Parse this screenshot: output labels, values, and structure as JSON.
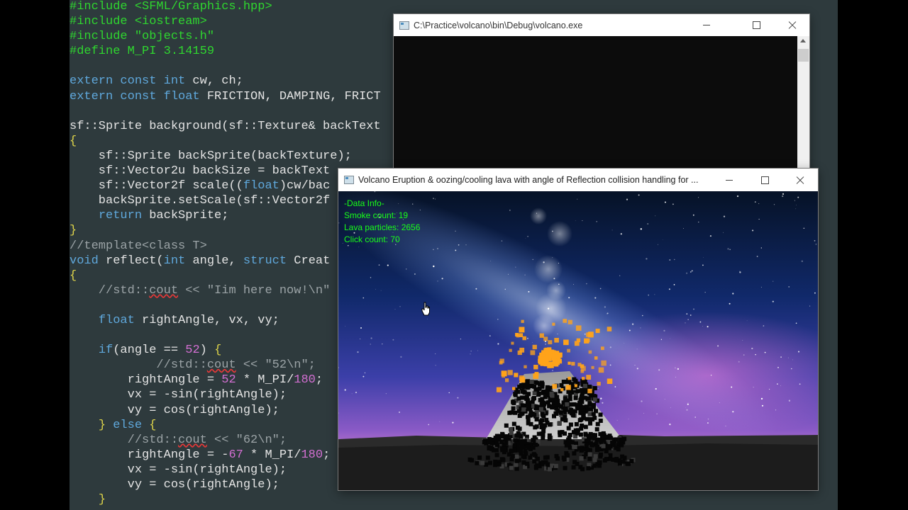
{
  "editor": {
    "lines": [
      [
        {
          "t": "#include <SFML/Graphics.hpp>",
          "c": "pp"
        }
      ],
      [
        {
          "t": "#include <iostream>",
          "c": "pp"
        }
      ],
      [
        {
          "t": "#include \"objects.h\"",
          "c": "pp"
        }
      ],
      [
        {
          "t": "#define M_PI 3.14159",
          "c": "pp"
        }
      ],
      [],
      [
        {
          "t": "extern const int",
          "c": "kw"
        },
        {
          "t": " cw, ch;"
        }
      ],
      [
        {
          "t": "extern const float",
          "c": "kw"
        },
        {
          "t": " FRICTION, DAMPING, FRICT"
        }
      ],
      [],
      [
        {
          "t": "sf::Sprite background(sf::Texture& backText"
        }
      ],
      [
        {
          "t": "{",
          "c": "br"
        }
      ],
      [
        {
          "t": "    sf::Sprite backSprite(backTexture);"
        }
      ],
      [
        {
          "t": "    sf::Vector2u backSize = backText"
        }
      ],
      [
        {
          "t": "    sf::Vector2f scale(("
        },
        {
          "t": "float",
          "c": "kw"
        },
        {
          "t": ")cw/bac"
        }
      ],
      [
        {
          "t": "    backSprite.setScale(sf::Vector2f"
        }
      ],
      [
        {
          "t": "    "
        },
        {
          "t": "return",
          "c": "kw"
        },
        {
          "t": " backSprite;"
        }
      ],
      [
        {
          "t": "}",
          "c": "br"
        }
      ],
      [
        {
          "t": "//template<class T>",
          "c": "cm"
        }
      ],
      [
        {
          "t": "void",
          "c": "kw"
        },
        {
          "t": " reflect("
        },
        {
          "t": "int",
          "c": "kw"
        },
        {
          "t": " angle, "
        },
        {
          "t": "struct",
          "c": "kw"
        },
        {
          "t": " Creat"
        }
      ],
      [
        {
          "t": "{",
          "c": "br"
        }
      ],
      [
        {
          "t": "    //std::",
          "c": "cm"
        },
        {
          "t": "cout",
          "c": "cm sq"
        },
        {
          "t": " << \"Iim here now!\\n\"",
          "c": "cm"
        }
      ],
      [],
      [
        {
          "t": "    "
        },
        {
          "t": "float",
          "c": "kw"
        },
        {
          "t": " rightAngle, vx, vy;"
        }
      ],
      [],
      [
        {
          "t": "    "
        },
        {
          "t": "if",
          "c": "kw"
        },
        {
          "t": "(angle == "
        },
        {
          "t": "52",
          "c": "nm"
        },
        {
          "t": ") "
        },
        {
          "t": "{",
          "c": "br"
        }
      ],
      [
        {
          "t": "            //std::",
          "c": "cm"
        },
        {
          "t": "cout",
          "c": "cm sq"
        },
        {
          "t": " << \"52\\n\";",
          "c": "cm"
        }
      ],
      [
        {
          "t": "        rightAngle = "
        },
        {
          "t": "52",
          "c": "nm"
        },
        {
          "t": " * M_PI/"
        },
        {
          "t": "180",
          "c": "nm"
        },
        {
          "t": ";"
        }
      ],
      [
        {
          "t": "        vx = -sin(rightAngle);"
        }
      ],
      [
        {
          "t": "        vy = cos(rightAngle);"
        }
      ],
      [
        {
          "t": "    "
        },
        {
          "t": "}",
          "c": "br"
        },
        {
          "t": " "
        },
        {
          "t": "else",
          "c": "kw"
        },
        {
          "t": " "
        },
        {
          "t": "{",
          "c": "br"
        }
      ],
      [
        {
          "t": "        //std::",
          "c": "cm"
        },
        {
          "t": "cout",
          "c": "cm sq"
        },
        {
          "t": " << \"62\\n\";",
          "c": "cm"
        }
      ],
      [
        {
          "t": "        rightAngle = -"
        },
        {
          "t": "67",
          "c": "nm"
        },
        {
          "t": " * M_PI/"
        },
        {
          "t": "180",
          "c": "nm"
        },
        {
          "t": ";"
        }
      ],
      [
        {
          "t": "        vx = -sin(rightAngle);"
        }
      ],
      [
        {
          "t": "        vy = cos(rightAngle);"
        }
      ],
      [
        {
          "t": "    "
        },
        {
          "t": "}",
          "c": "br"
        }
      ]
    ]
  },
  "console_window": {
    "title": "C:\\Practice\\volcano\\bin\\Debug\\volcano.exe"
  },
  "sfml_window": {
    "title": "Volcano Eruption & oozing/cooling lava with angle of Reflection collision handling for ...",
    "info": {
      "heading": "-Data Info-",
      "smoke": "Smoke count: 19",
      "lava": "Lava particles: 2656",
      "clicks": "Click count: 70"
    }
  },
  "colors": {
    "info_text": "#18ff18",
    "lava": "#ffa31a"
  },
  "icons": {
    "minimize": "minimize-icon",
    "maximize": "maximize-icon",
    "close": "close-icon",
    "cursor": "hand-cursor-icon"
  }
}
